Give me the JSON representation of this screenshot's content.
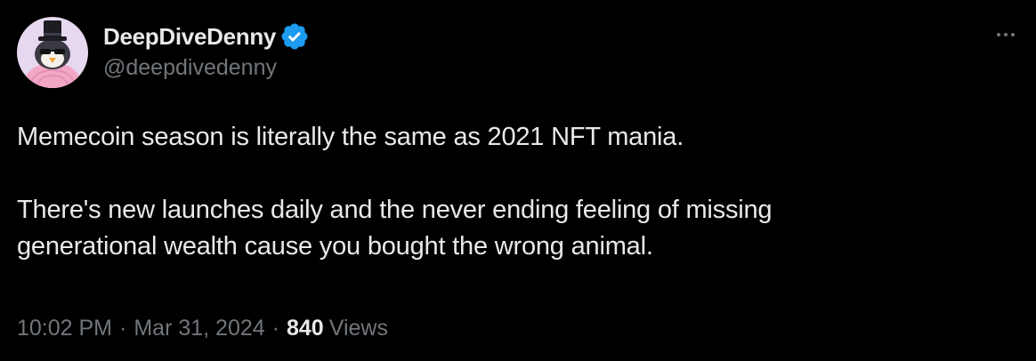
{
  "author": {
    "display_name": "DeepDiveDenny",
    "handle": "@deepdivedenny",
    "verified": true,
    "avatar_icon": "penguin-top-hat-avatar"
  },
  "tweet": {
    "paragraphs": [
      [
        "Memecoin season is literally the same as 2021 NFT mania."
      ],
      [
        "There's new launches daily and the never ending feeling of missing",
        "generational wealth cause you bought the wrong animal."
      ]
    ]
  },
  "meta": {
    "time": "10:02 PM",
    "separator": "·",
    "date": "Mar 31, 2024",
    "views_count": "840",
    "views_label": "Views"
  },
  "icons": {
    "verified": "verified-badge-icon",
    "more": "more-options-icon"
  },
  "colors": {
    "background": "#000000",
    "text_primary": "#e7e9ea",
    "text_secondary": "#71767b",
    "verified_blue": "#1d9bf0",
    "avatar_bg": "#e6d8ef",
    "avatar_sweater": "#f2a7c6"
  }
}
